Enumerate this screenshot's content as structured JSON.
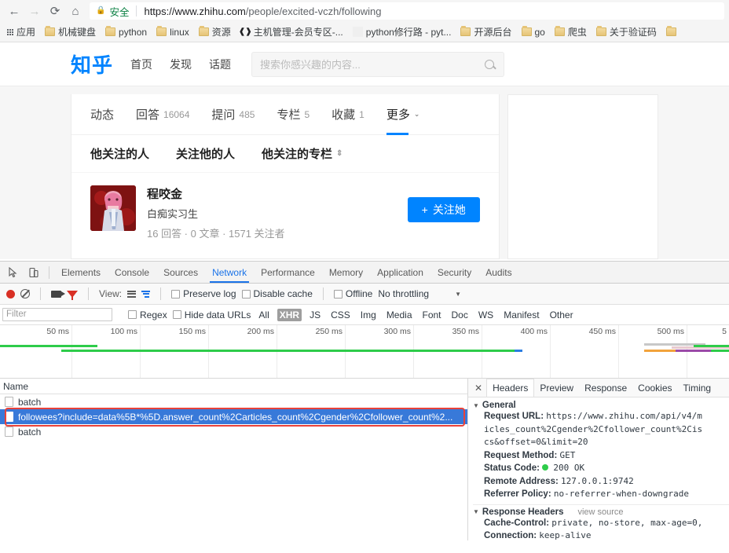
{
  "browser": {
    "nav": {
      "back": "←",
      "forward": "→",
      "reload": "⟳",
      "home": "⌂"
    },
    "omnibox": {
      "lock_icon": "lock-icon",
      "secure_label": "安全",
      "url_host": "https://www.zhihu.com",
      "url_path": "/people/excited-vczh/following"
    },
    "bookmarks": [
      {
        "label": "应用",
        "icon": "apps-grid-icon"
      },
      {
        "label": "机械键盘",
        "icon": "folder-icon"
      },
      {
        "label": "python",
        "icon": "folder-icon"
      },
      {
        "label": "linux",
        "icon": "folder-icon"
      },
      {
        "label": "资源",
        "icon": "folder-icon"
      },
      {
        "label": "主机管理-会员专区-...",
        "icon": "site-icon"
      },
      {
        "label": "python修行路 - pyt...",
        "icon": "site-icon"
      },
      {
        "label": "开源后台",
        "icon": "folder-icon"
      },
      {
        "label": "go",
        "icon": "folder-icon"
      },
      {
        "label": "爬虫",
        "icon": "folder-icon"
      },
      {
        "label": "关于验证码",
        "icon": "folder-icon"
      },
      {
        "label": "",
        "icon": "folder-icon"
      }
    ]
  },
  "zhihu": {
    "logo": "知乎",
    "nav": [
      "首页",
      "发现",
      "话题"
    ],
    "search_placeholder": "搜索你感兴趣的内容...",
    "search_icon": "search-icon",
    "tabs": [
      {
        "label": "动态",
        "count": ""
      },
      {
        "label": "回答",
        "count": "16064"
      },
      {
        "label": "提问",
        "count": "485"
      },
      {
        "label": "专栏",
        "count": "5"
      },
      {
        "label": "收藏",
        "count": "1"
      },
      {
        "label": "更多",
        "count": "",
        "caret": "⌄",
        "active": true
      }
    ],
    "subtabs": [
      {
        "label": "他关注的人"
      },
      {
        "label": "关注他的人"
      },
      {
        "label": "他关注的专栏",
        "sort_icon": "sort-icon"
      }
    ],
    "person": {
      "name": "程咬金",
      "bio": "白痴实习生",
      "meta": "16 回答 · 0 文章 · 1571 关注者",
      "avatar": "user-avatar",
      "follow_label": "关注她",
      "follow_plus": "+",
      "follow_color": "#0084ff"
    }
  },
  "devtools": {
    "inspect_icon": "inspect-element-icon",
    "device_icon": "device-toolbar-icon",
    "panels": [
      "Elements",
      "Console",
      "Sources",
      "Network",
      "Performance",
      "Memory",
      "Application",
      "Security",
      "Audits"
    ],
    "active_panel": "Network",
    "toolbar": {
      "record_icon": "record-icon",
      "clear_icon": "clear-icon",
      "capture_screenshots_icon": "camera-icon",
      "filter_icon": "funnel-icon",
      "view_label": "View:",
      "view_list_icon": "list-view-icon",
      "view_waterfall_icon": "waterfall-view-icon",
      "preserve_log": "Preserve log",
      "disable_cache": "Disable cache",
      "offline": "Offline",
      "throttling": "No throttling",
      "throttling_caret": "▼"
    },
    "filterbar": {
      "filter_placeholder": "Filter",
      "regex": "Regex",
      "hide_data_urls": "Hide data URLs",
      "types": [
        "All",
        "XHR",
        "JS",
        "CSS",
        "Img",
        "Media",
        "Font",
        "Doc",
        "WS",
        "Manifest",
        "Other"
      ],
      "selected_type": "XHR"
    },
    "timeline": {
      "ticks": [
        "50 ms",
        "100 ms",
        "150 ms",
        "200 ms",
        "250 ms",
        "300 ms",
        "350 ms",
        "400 ms",
        "450 ms",
        "500 ms",
        "5"
      ]
    },
    "requests": {
      "column_header": "Name",
      "rows": [
        {
          "name": "batch",
          "selected": false
        },
        {
          "name": "followees?include=data%5B*%5D.answer_count%2Carticles_count%2Cgender%2Cfollower_count%2...",
          "selected": true,
          "highlighted": true
        },
        {
          "name": "batch",
          "selected": false
        }
      ]
    },
    "details": {
      "close_icon": "close-icon",
      "tabs": [
        "Headers",
        "Preview",
        "Response",
        "Cookies",
        "Timing"
      ],
      "active_tab": "Headers",
      "general_title": "General",
      "general": [
        {
          "key": "Request URL:",
          "value": "https://www.zhihu.com/api/v4/m\nicles_count%2Cgender%2Cfollower_count%2Cis\ncs&offset=0&limit=20"
        },
        {
          "key": "Request Method:",
          "value": "GET"
        },
        {
          "key": "Status Code:",
          "value": "200 OK",
          "status_dot": true
        },
        {
          "key": "Remote Address:",
          "value": "127.0.0.1:9742"
        },
        {
          "key": "Referrer Policy:",
          "value": "no-referrer-when-downgrade"
        }
      ],
      "response_title": "Response Headers",
      "view_source": "view source",
      "response": [
        {
          "key": "Cache-Control:",
          "value": "private, no-store, max-age=0,"
        },
        {
          "key": "Connection:",
          "value": "keep-alive"
        }
      ]
    }
  }
}
